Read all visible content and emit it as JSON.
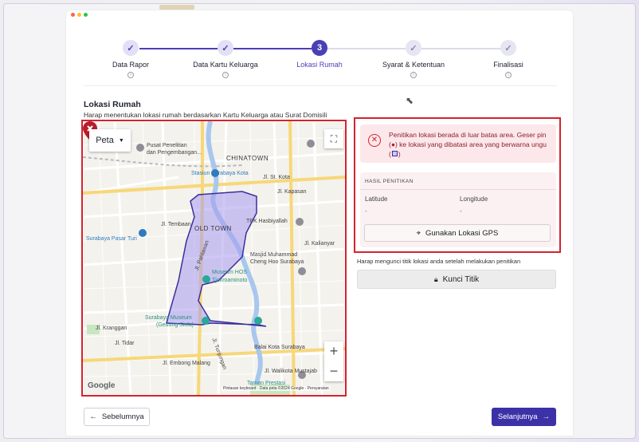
{
  "stepper": {
    "steps": [
      {
        "label": "Data Rapor",
        "state": "done",
        "mark": "✓"
      },
      {
        "label": "Data Kartu Keluarga",
        "state": "done",
        "mark": "✓"
      },
      {
        "label": "Lokasi Rumah",
        "state": "active",
        "mark": "3"
      },
      {
        "label": "Syarat & Ketentuan",
        "state": "todo",
        "mark": "✓"
      },
      {
        "label": "Finalisasi",
        "state": "todo",
        "mark": "✓"
      }
    ]
  },
  "section": {
    "title": "Lokasi Rumah",
    "subtitle": "Harap menentukan lokasi rumah berdasarkan Kartu Keluarga atau Surat Domisili"
  },
  "map": {
    "type_button": "Peta",
    "zoom_in": "+",
    "zoom_out": "−",
    "google": "Google",
    "attribution": "Pintasan keyboard · Data peta ©2024 Google · Persyaratan",
    "labels": {
      "chinatown": "CHINATOWN",
      "oldtown": "OLD TOWN",
      "stasiun": "Stasiun Surabaya Kota",
      "pusat": "Pusat Penelitian",
      "pusat2": "dan Pengembangan...",
      "tpk": "TPK Hasbiyallah",
      "masjid": "Masjid Muhammad",
      "masjid2": "Cheng Hoo Surabaya",
      "museum": "Museum HOS",
      "museum2": "Tjokroaminoto",
      "sbymuseum": "Surabaya Museum",
      "sbymuseum2": "(Gedung Siola)",
      "balai": "Balai Kota Surabaya",
      "taman": "Taman Prestasi",
      "pasar": "Surabaya Pasar Turi",
      "kranggan": "Jl. Kranggan",
      "tembaan": "Jl. Tembaan",
      "embong": "Jl. Embong Malang",
      "kalianyar": "Jl. Kalianyar",
      "tidar": "Jl. Tidar",
      "walikota": "Jl. Walikota Mustajab",
      "kapasan": "Jl. Kapasan",
      "stkota": "Jl. St. Kota",
      "pahlawan": "Jl. Pahlawan",
      "tunjungan": "Jl. Tunjungan"
    }
  },
  "alert": {
    "text_before": "Penitikan lokasi berada di luar batas area. Geser pin (",
    "text_mid": ") ke lokasi yang dibatasi area yang berwarna ungu (",
    "text_after": ")"
  },
  "hasil": {
    "title": "HASIL PENITIKAN",
    "latitude_label": "Latitude",
    "latitude_value": "-",
    "longitude_label": "Longitude",
    "longitude_value": "-",
    "gps_button": "Gunakan Lokasi GPS"
  },
  "lock": {
    "note": "Harap mengunci titik lokasi anda setelah melakukan penitikan",
    "button": "Kunci Titik"
  },
  "footer": {
    "prev": "Sebelumnya",
    "next": "Selanjutnya"
  },
  "colors": {
    "primary": "#3d31a8",
    "error": "#d4232e",
    "area_fill": "#a79af0"
  }
}
